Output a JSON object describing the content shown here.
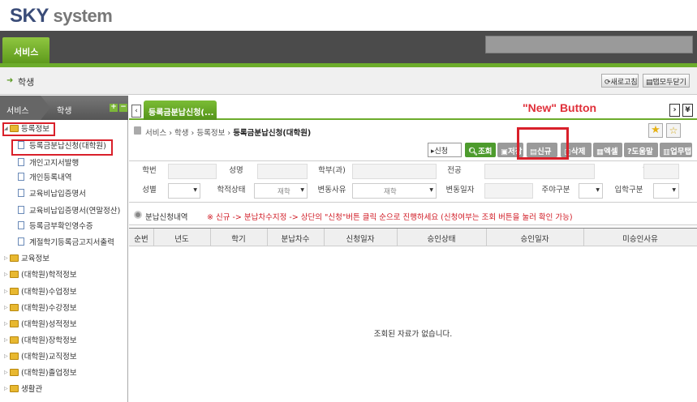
{
  "logo": {
    "brand": "SKY",
    "suffix": " system"
  },
  "topnav": {
    "service_tab": "서비스"
  },
  "subbar": {
    "title": "학생",
    "refresh": "새로고침",
    "close_all": "탭모두닫기"
  },
  "sidebar": {
    "head_service": "서비스",
    "head_student": "학생",
    "plus": "+",
    "minus": "−",
    "tree": [
      {
        "label": "등록정보",
        "type": "folder-open"
      },
      {
        "label": "등록금분납신청(대학원)",
        "type": "doc"
      },
      {
        "label": "개인고지서발행",
        "type": "doc"
      },
      {
        "label": "개인등록내역",
        "type": "doc"
      },
      {
        "label": "교육비납입증명서",
        "type": "doc"
      },
      {
        "label": "교육비납입증명서(연말정산)",
        "type": "doc"
      },
      {
        "label": "등록금부확인영수증",
        "type": "doc"
      },
      {
        "label": "계절학기등록금고지서출력",
        "type": "doc"
      },
      {
        "label": "교육정보",
        "type": "folder"
      },
      {
        "label": "(대학원)학적정보",
        "type": "folder"
      },
      {
        "label": "(대학원)수업정보",
        "type": "folder"
      },
      {
        "label": "(대학원)수강정보",
        "type": "folder"
      },
      {
        "label": "(대학원)성적정보",
        "type": "folder"
      },
      {
        "label": "(대학원)장학정보",
        "type": "folder"
      },
      {
        "label": "(대학원)교직정보",
        "type": "folder"
      },
      {
        "label": "(대학원)졸업정보",
        "type": "folder"
      },
      {
        "label": "생활관",
        "type": "folder"
      }
    ]
  },
  "main": {
    "tab_label": "등록금분납신청(...",
    "annotation": "\"New\"  Button",
    "breadcrumb": {
      "prefix": "서비스 › 학생 › 등록정보 › ",
      "current": "등록금분납신청(대학원)"
    },
    "actions": {
      "apply_select": "▸신청",
      "search": "조회",
      "save": "저장",
      "new": "신규",
      "delete": "삭제",
      "excel": "엑셀",
      "help": "도움말",
      "manual": "업무탭"
    },
    "form": {
      "student_no": "학번",
      "name": "성명",
      "dept": "학부(과)",
      "major": "전공",
      "year_class": "학년(반)",
      "gender": "성별",
      "status": "학적상태",
      "status_value": "재학",
      "change_reason": "변동사유",
      "change_value": "재학",
      "change_date": "변동일자",
      "day_night": "주야구분",
      "entry_type": "입학구분"
    },
    "info": {
      "label": "분납신청내역",
      "note": "※ 신규 -> 분납차수지정 -> 상단의 \"신청\"버튼 클릭 순으로 진행하세요 (신청여부는 조회 버튼을 눌러 확인 가능)"
    },
    "grid": {
      "columns": [
        "순번",
        "년도",
        "학기",
        "분납차수",
        "신청일자",
        "승인상태",
        "승인일자",
        "미승인사유"
      ],
      "empty": "조회된 자료가 없습니다."
    }
  },
  "colors": {
    "accent_green": "#6cac2b",
    "highlight_red": "#d9202a"
  }
}
